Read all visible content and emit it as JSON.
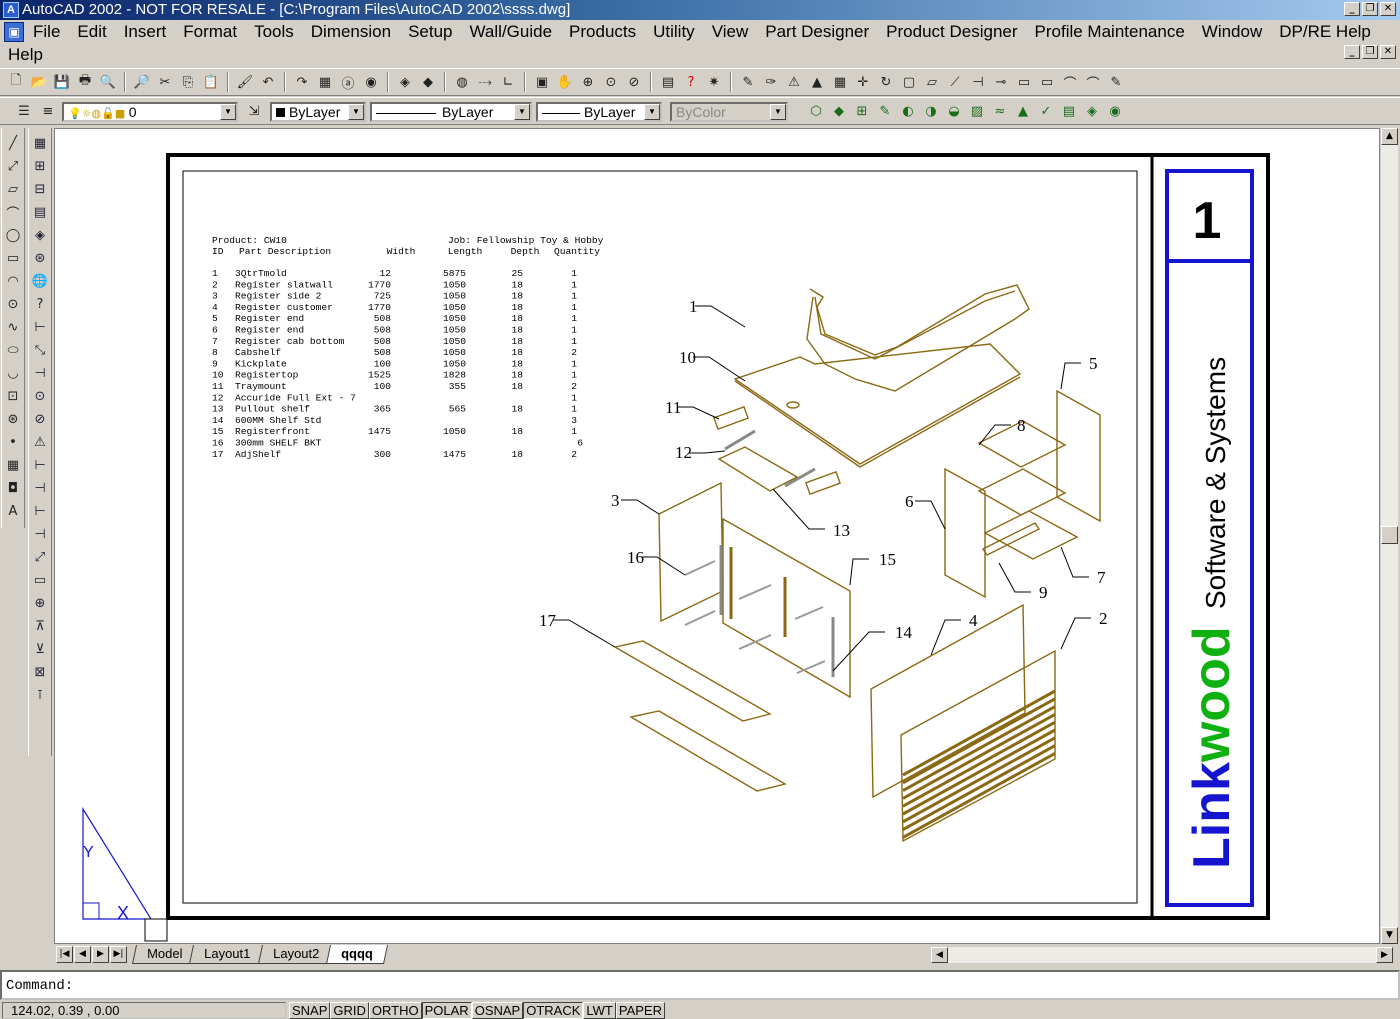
{
  "window": {
    "title": "AutoCAD 2002 - NOT FOR RESALE - [C:\\Program Files\\AutoCAD 2002\\ssss.dwg]",
    "minimize": "_",
    "restore": "❐",
    "close": "✕"
  },
  "menu": {
    "items": [
      "File",
      "Edit",
      "Insert",
      "Format",
      "Tools",
      "Dimension",
      "Setup",
      "Wall/Guide",
      "Products",
      "Utility",
      "View",
      "Part Designer",
      "Product Designer",
      "Profile Maintenance",
      "Window",
      "DP/RE Help"
    ],
    "help": "Help"
  },
  "layers": {
    "layer_value": "0",
    "color_value": "ByLayer",
    "linetype_value": "ByLayer",
    "lineweight_value": "ByLayer",
    "plotstyle_value": "ByColor"
  },
  "table": {
    "header": {
      "product": "Product: CW10",
      "job": "Job: Fellowship Toy & Hobby",
      "cols": [
        "ID",
        "Part Description",
        "Width",
        "Length",
        "Depth",
        "Quantity"
      ]
    },
    "rows": [
      {
        "id": "1",
        "desc": "3QtrTmold",
        "width": "12",
        "length": "5875",
        "depth": "25",
        "qty": "1"
      },
      {
        "id": "2",
        "desc": "Register slatwall",
        "width": "1770",
        "length": "1050",
        "depth": "18",
        "qty": "1"
      },
      {
        "id": "3",
        "desc": "Register side 2",
        "width": "725",
        "length": "1050",
        "depth": "18",
        "qty": "1"
      },
      {
        "id": "4",
        "desc": "Register customer",
        "width": "1770",
        "length": "1050",
        "depth": "18",
        "qty": "1"
      },
      {
        "id": "5",
        "desc": "Register end",
        "width": "508",
        "length": "1050",
        "depth": "18",
        "qty": "1"
      },
      {
        "id": "6",
        "desc": "Register end",
        "width": "508",
        "length": "1050",
        "depth": "18",
        "qty": "1"
      },
      {
        "id": "7",
        "desc": "Register cab bottom",
        "width": "508",
        "length": "1050",
        "depth": "18",
        "qty": "1"
      },
      {
        "id": "8",
        "desc": "Cabshelf",
        "width": "508",
        "length": "1050",
        "depth": "18",
        "qty": "2"
      },
      {
        "id": "9",
        "desc": "Kickplate",
        "width": "100",
        "length": "1050",
        "depth": "18",
        "qty": "1"
      },
      {
        "id": "10",
        "desc": "Registertop",
        "width": "1525",
        "length": "1828",
        "depth": "18",
        "qty": "1"
      },
      {
        "id": "11",
        "desc": "Traymount",
        "width": "100",
        "length": "355",
        "depth": "18",
        "qty": "2"
      },
      {
        "id": "12",
        "desc": "Accuride Full Ext - 7",
        "width": "",
        "length": "",
        "depth": "",
        "qty": "1"
      },
      {
        "id": "13",
        "desc": "Pullout shelf",
        "width": "365",
        "length": "565",
        "depth": "18",
        "qty": "1"
      },
      {
        "id": "14",
        "desc": "600MM Shelf Std",
        "width": "",
        "length": "",
        "depth": "",
        "qty": "3"
      },
      {
        "id": "15",
        "desc": "Registerfront",
        "width": "1475",
        "length": "1050",
        "depth": "18",
        "qty": "1"
      },
      {
        "id": "16",
        "desc": "300mm SHELF BKT",
        "width": "",
        "length": "",
        "depth": "",
        "qty": "6"
      },
      {
        "id": "17",
        "desc": "AdjShelf",
        "width": "300",
        "length": "1475",
        "depth": "18",
        "qty": "2"
      }
    ]
  },
  "titleblock": {
    "sheet_number": "1",
    "brand_link": "Link",
    "brand_wood": "wood",
    "tagline": "Software & Systems",
    "brand_color": "#1515d0",
    "accent_color": "#10b010"
  },
  "callouts": [
    "1",
    "10",
    "11",
    "12",
    "13",
    "3",
    "16",
    "17",
    "15",
    "14",
    "5",
    "8",
    "6",
    "9",
    "7",
    "4",
    "2"
  ],
  "ucs": {
    "y": "Y",
    "x": "X"
  },
  "tabs": [
    "Model",
    "Layout1",
    "Layout2",
    "qqqq"
  ],
  "active_tab": "qqqq",
  "command": {
    "prompt": "Command:"
  },
  "status": {
    "coords": "124.02, 0.39 , 0.00",
    "buttons": [
      "SNAP",
      "GRID",
      "ORTHO",
      "POLAR",
      "OSNAP",
      "OTRACK",
      "LWT",
      "PAPER"
    ],
    "on": [
      "POLAR",
      "OTRACK"
    ]
  },
  "icons": {
    "toolbar1": [
      "new-icon",
      "open-icon",
      "save-icon",
      "print-icon",
      "preview-icon",
      "find-icon",
      "cut-icon",
      "copy-icon",
      "paste-icon",
      "matchprop-icon",
      "undo-icon",
      "redo-icon",
      "design-center-icon",
      "hyperlink-icon",
      "web-icon",
      "publish-icon",
      "3d-icon",
      "globe-icon",
      "snap-from-icon",
      "ucs-icon",
      "named-views-icon",
      "pan-icon",
      "zoom-realtime-icon",
      "zoom-window-icon",
      "zoom-previous-icon",
      "properties-icon",
      "help-icon",
      "today-icon"
    ],
    "left": [
      "line-icon",
      "construction-line-icon",
      "polyline-icon",
      "arc-icon",
      "circle-icon",
      "rectangle-icon"
    ]
  }
}
